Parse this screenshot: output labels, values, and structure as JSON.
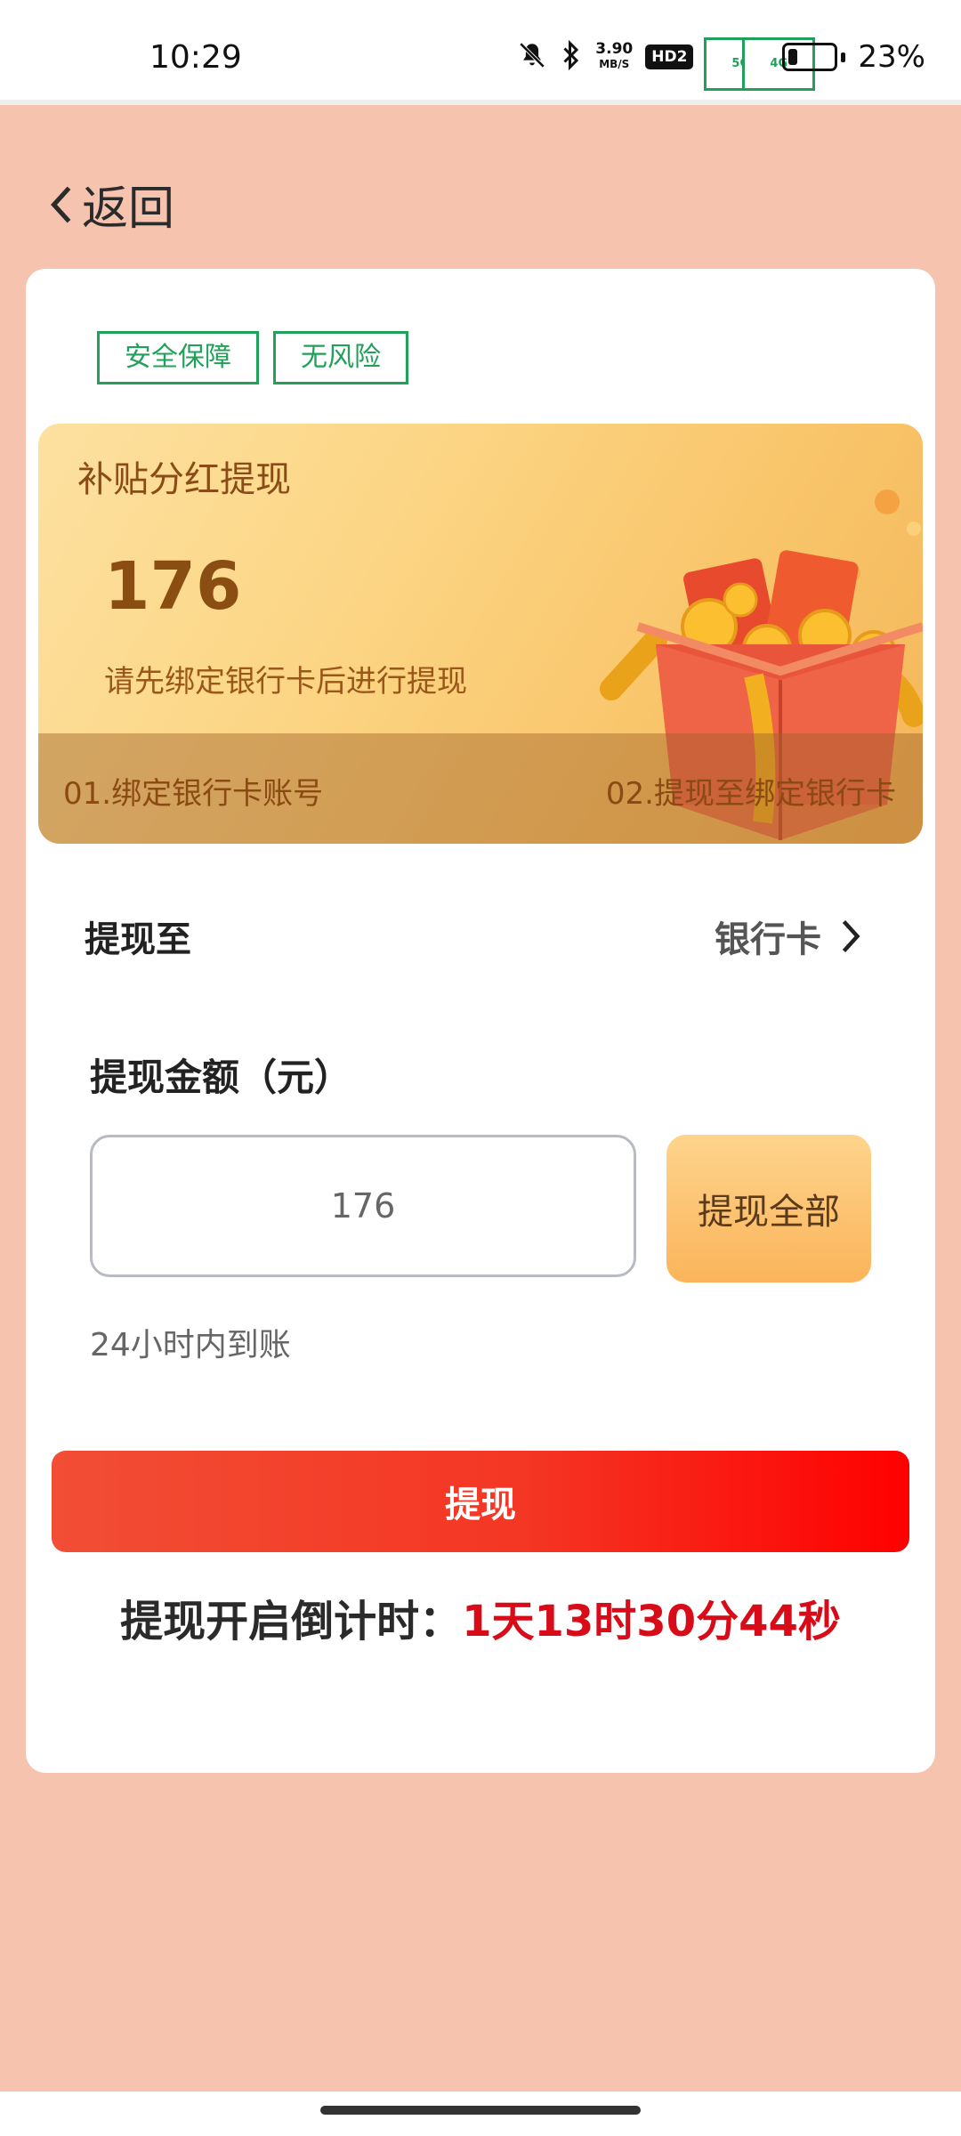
{
  "status_bar": {
    "time": "10:29",
    "net_speed_value": "3.90",
    "net_speed_unit": "MB/S",
    "hd_badge": "HD2",
    "signal1_tag": "5G",
    "signal2_tag": "4G",
    "battery_percent": "23%",
    "battery_level": 0.23
  },
  "nav": {
    "back_label": "返回"
  },
  "tags": [
    "安全保障",
    "无风险"
  ],
  "banner": {
    "title": "补贴分红提现",
    "amount": "176",
    "hint": "请先绑定银行卡后进行提现",
    "step1": "01.绑定银行卡账号",
    "step2": "02.提现至绑定银行卡"
  },
  "withdraw_to": {
    "label": "提现至",
    "value": "银行卡"
  },
  "amount": {
    "label": "提现金额（元）",
    "value": "176",
    "withdraw_all_label": "提现全部",
    "arrival_note": "24小时内到账"
  },
  "actions": {
    "withdraw_label": "提现"
  },
  "countdown": {
    "label": "提现开启倒计时：",
    "value": "1天13时30分44秒"
  },
  "colors": {
    "background": "#f5c3ae",
    "accent_red": "#d80c18",
    "tag_green": "#21a05a",
    "banner_text": "#8b4e12"
  }
}
